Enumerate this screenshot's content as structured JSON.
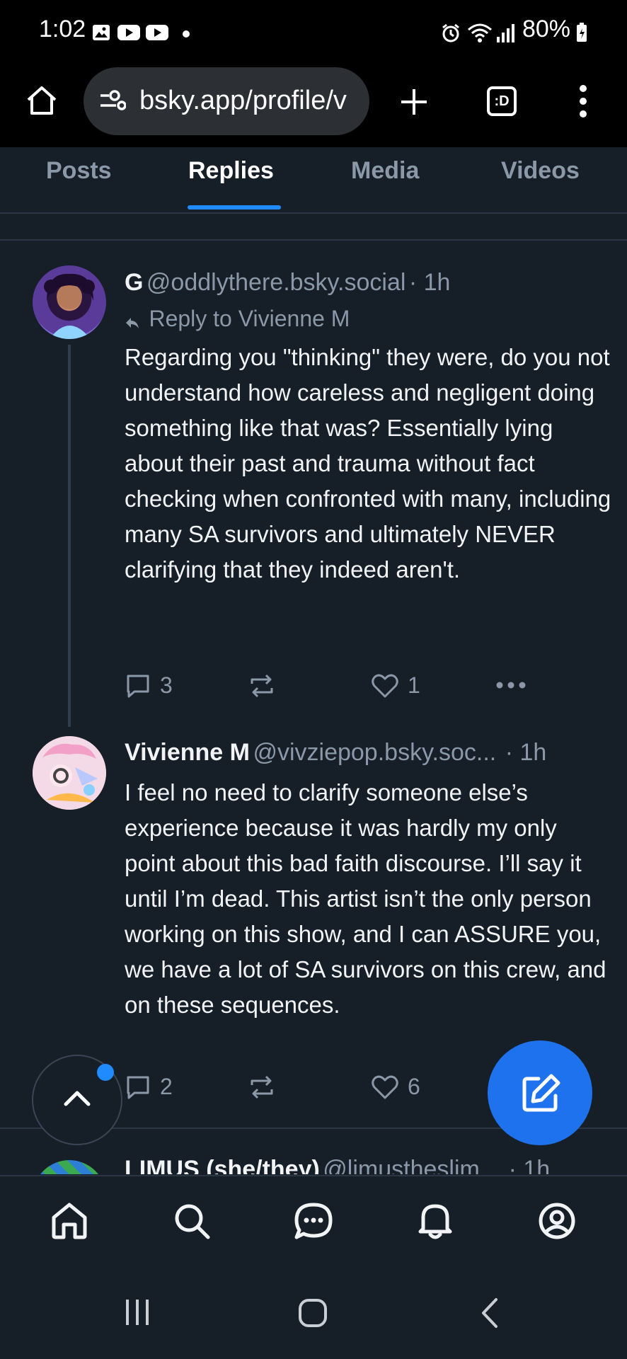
{
  "status_bar": {
    "time": "1:02",
    "battery": "80%"
  },
  "browser": {
    "url": "bsky.app/profile/v",
    "tab_count_label": ":D"
  },
  "tabs": [
    {
      "label": "Posts"
    },
    {
      "label": "Replies"
    },
    {
      "label": "Media"
    },
    {
      "label": "Videos"
    }
  ],
  "posts": [
    {
      "author": "G",
      "handle": "@oddlythere.bsky.social",
      "time": "· 1h",
      "reply_to": "Reply to Vivienne M",
      "text": "Regarding you \"thinking\" they were, do you not understand how careless and negligent doing something like that was? Essentially lying about their past and trauma without fact checking when confronted with many, including many SA survivors and ultimately NEVER clarifying that they indeed aren't.",
      "replies": "3",
      "reposts": "",
      "likes": "1"
    },
    {
      "author": "Vivienne M",
      "handle": "@vivziepop.bsky.soc...",
      "time": "· 1h",
      "text": "I feel no need to clarify someone else’s experience because it was hardly my only point about this bad faith discourse. I’ll say it until I’m dead. This artist isn’t the only person working on this show, and I can ASSURE you, we have a lot of SA survivors on this crew, and on these sequences.",
      "replies": "2",
      "reposts": "",
      "likes": "6"
    },
    {
      "author": "LIMUS (she/they)",
      "handle": "@limustheslim...",
      "time": "· 1h"
    }
  ],
  "colors": {
    "accent": "#1f8bff",
    "fab": "#1f72ee",
    "background": "#161e27"
  }
}
